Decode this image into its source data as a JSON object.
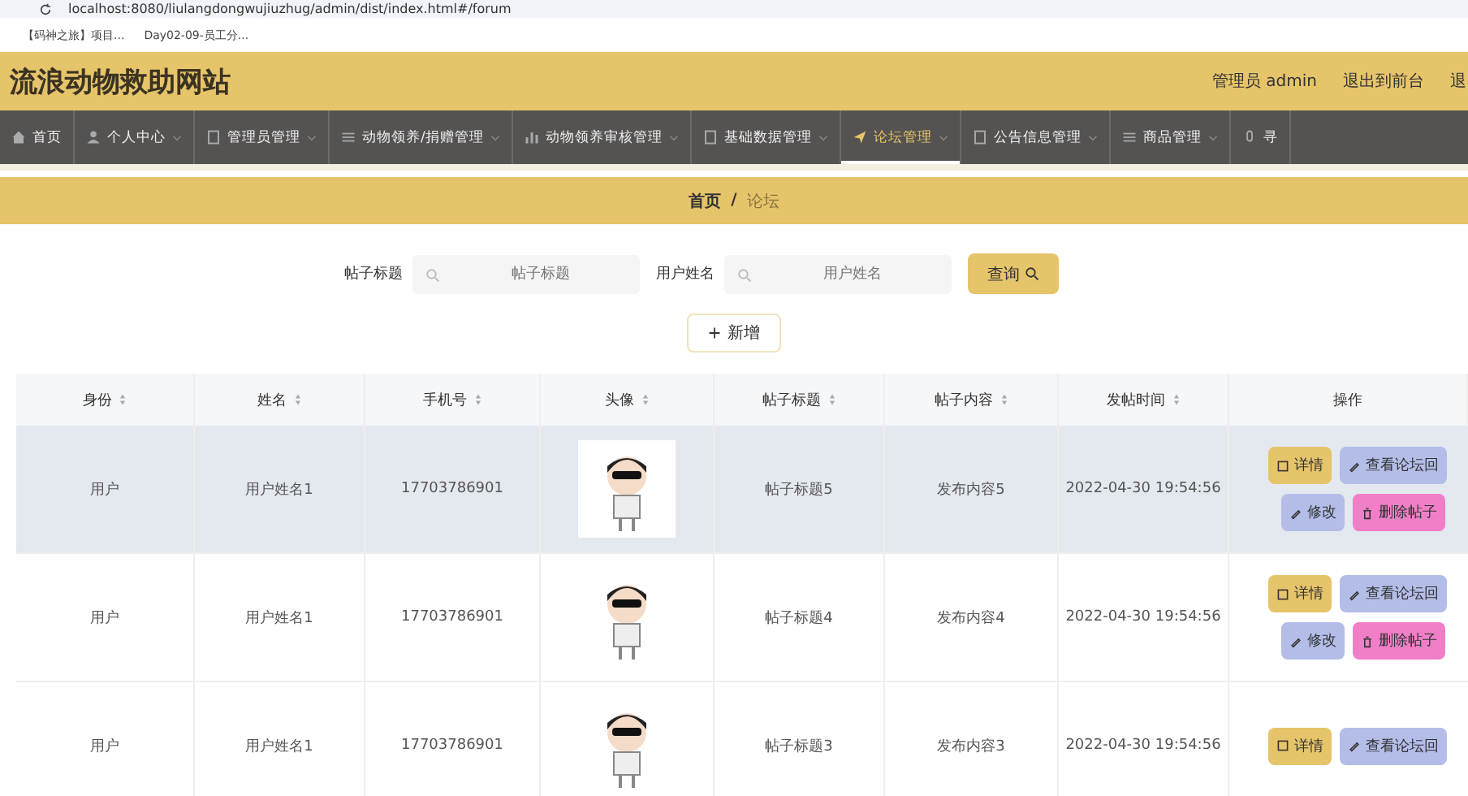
{
  "browser": {
    "url": "localhost:8080/liulangdongwujiuzhug/admin/dist/index.html#/forum",
    "bookmarks": [
      "【码神之旅】项目...",
      "Day02-09-员工分..."
    ]
  },
  "header": {
    "title": "流浪动物救助网站",
    "links": [
      "管理员 admin",
      "退出到前台",
      "退"
    ]
  },
  "nav": [
    {
      "label": "首页",
      "kind": "home",
      "selected": false,
      "dropdown": false
    },
    {
      "label": "个人中心",
      "kind": "user",
      "selected": false,
      "dropdown": true
    },
    {
      "label": "管理员管理",
      "kind": "doc",
      "selected": false,
      "dropdown": true
    },
    {
      "label": "动物领养/捐赠管理",
      "kind": "list",
      "selected": false,
      "dropdown": true
    },
    {
      "label": "动物领养审核管理",
      "kind": "chart",
      "selected": false,
      "dropdown": true
    },
    {
      "label": "基础数据管理",
      "kind": "doc",
      "selected": false,
      "dropdown": true
    },
    {
      "label": "论坛管理",
      "kind": "send",
      "selected": true,
      "dropdown": true
    },
    {
      "label": "公告信息管理",
      "kind": "doc",
      "selected": false,
      "dropdown": true
    },
    {
      "label": "商品管理",
      "kind": "list",
      "selected": false,
      "dropdown": true
    },
    {
      "label": "寻",
      "kind": "mic",
      "selected": false,
      "dropdown": false
    }
  ],
  "breadcrumb": {
    "items": [
      "首页",
      "论坛"
    ],
    "separator": "/"
  },
  "search": {
    "fields": [
      {
        "label": "帖子标题",
        "placeholder": "帖子标题"
      },
      {
        "label": "用户姓名",
        "placeholder": "用户姓名"
      }
    ],
    "button": "查询"
  },
  "add_button": "新增",
  "table": {
    "columns": [
      {
        "label": "身份",
        "sortable": true
      },
      {
        "label": "姓名",
        "sortable": true
      },
      {
        "label": "手机号",
        "sortable": true
      },
      {
        "label": "头像",
        "sortable": true
      },
      {
        "label": "帖子标题",
        "sortable": true
      },
      {
        "label": "帖子内容",
        "sortable": true
      },
      {
        "label": "发帖时间",
        "sortable": true
      },
      {
        "label": "操作",
        "sortable": false
      }
    ],
    "rows": [
      {
        "selected": true,
        "cells": [
          "用户",
          "用户姓名1",
          "17703786901",
          "",
          "帖子标题5",
          "发布内容5",
          "2022-04-30 19:54:56"
        ],
        "actions": [
          {
            "kind": "detail",
            "label": "详情"
          },
          {
            "kind": "replies",
            "label": "查看论坛回"
          },
          {
            "kind": "edit",
            "label": "修改"
          },
          {
            "kind": "delete",
            "label": "删除帖子"
          }
        ]
      },
      {
        "selected": false,
        "cells": [
          "用户",
          "用户姓名1",
          "17703786901",
          "",
          "帖子标题4",
          "发布内容4",
          "2022-04-30 19:54:56"
        ],
        "actions": [
          {
            "kind": "detail",
            "label": "详情"
          },
          {
            "kind": "replies",
            "label": "查看论坛回"
          },
          {
            "kind": "edit",
            "label": "修改"
          },
          {
            "kind": "delete",
            "label": "删除帖子"
          }
        ]
      },
      {
        "selected": false,
        "cells": [
          "用户",
          "用户姓名1",
          "17703786901",
          "",
          "帖子标题3",
          "发布内容3",
          "2022-04-30 19:54:56"
        ],
        "actions": [
          {
            "kind": "detail",
            "label": "详情"
          },
          {
            "kind": "replies",
            "label": "查看论坛回"
          }
        ]
      }
    ]
  }
}
